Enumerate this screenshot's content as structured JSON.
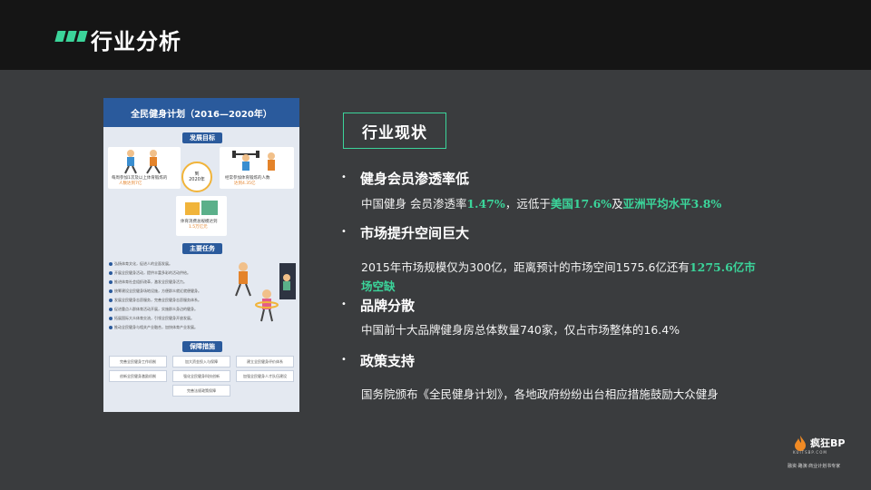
{
  "header": {
    "title": "行业分析"
  },
  "poster": {
    "title": "全民健身计划（2016—2020年）",
    "section_goals": "发展目标",
    "goal_left": "每周参加1次及以上体育锻炼的",
    "goal_left_2": "人数达到7亿",
    "circle_line1": "到",
    "circle_line2": "2020年",
    "goal_right": "经常参加体育锻炼的人数",
    "goal_right_2": "达到4.35亿",
    "goal_bottom": "体育消费总规模达到",
    "goal_bottom_2": "1.5万亿元",
    "section_tasks": "主要任务",
    "tasks": [
      "弘扬体育文化，促进人的全面发展。",
      "开展全民健身活动，提供丰富多彩的活动供给。",
      "推进体育社会组织改革，激发全民健身活力。",
      "统筹建设全民健身场地设施，方便群众就近就便健身。",
      "发展全民健身志愿服务，完善全民健身志愿服务体系。",
      "促进重点人群体育活动开展，实施群众身边的健身。",
      "拓展国际大众体育交流，引领全民健身开放发展。",
      "推动全民健身与相关产业融合，加快体育产业发展。"
    ],
    "section_measures": "保障措施",
    "measures": [
      "完善全民健身工作机制",
      "加大资金投入与保障",
      "建立全民健身评价体系",
      "创新全民健身激励机制",
      "强化全民健身科技创新",
      "加强全民健身人才队伍建设",
      "完善法规政策保障"
    ]
  },
  "main": {
    "status_label": "行业现状",
    "items": [
      {
        "bullet": "•",
        "heading": "健身会员渗透率低",
        "desc_a": "中国健身 会员渗透率",
        "desc_hl1": "1.47%",
        "desc_b": "，远低于",
        "desc_hl2": "美国17.6%",
        "desc_c": "及",
        "desc_hl3": "亚洲平均水平3.8%"
      },
      {
        "bullet": "•",
        "heading": "市场提升空间巨大",
        "desc_a": "2015年市场规模仅为300亿，距离预计的市场空间1575.6亿还有",
        "desc_hl1": "1275.6亿市",
        "desc_hl2": "场空缺"
      },
      {
        "bullet": "•",
        "heading": "品牌分散",
        "desc_a": "中国前十大品牌健身房总体数量740家，仅占市场整体的16.4%"
      },
      {
        "bullet": "•",
        "heading": "政策支持",
        "desc_a": "国务院颁布《全民健身计划》，各地政府纷纷出台相应措施鼓励大众健身"
      }
    ]
  },
  "brand": {
    "name": "疯狂BP",
    "sub": "KUITSBP.COM",
    "tag": "融资·路演·商业计划书专家"
  },
  "colors": {
    "accent": "#3bd49a",
    "background": "#3a3c3e",
    "topbar": "#151515",
    "poster_blue": "#2a5a9c"
  }
}
